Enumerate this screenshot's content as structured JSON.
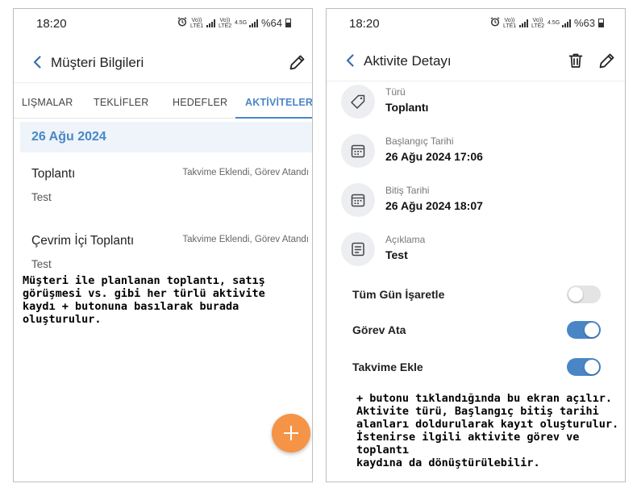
{
  "left": {
    "status": {
      "time": "18:20",
      "net1": "Vo)) LTE1",
      "net2": "Vo)) LTE2",
      "net3": "4.5G",
      "battery": "%64"
    },
    "appbar": {
      "title": "Müşteri Bilgileri"
    },
    "tabs": [
      {
        "label": "LIŞMALAR"
      },
      {
        "label": "TEKLİFLER"
      },
      {
        "label": "HEDEFLER"
      },
      {
        "label": "AKTİVİTELER",
        "active": true
      }
    ],
    "date_header": "26 Ağu 2024",
    "activities": [
      {
        "title": "Toplantı",
        "subtitle": "Test",
        "tags": "Takvime Eklendi, Görev Atandı"
      },
      {
        "title": "Çevrim İçi Toplantı",
        "subtitle": "Test",
        "tags": "Takvime Eklendi, Görev Atandı"
      }
    ],
    "note": "Müşteri ile planlanan toplantı, satış\ngörüşmesi vs. gibi her türlü aktivite\nkaydı + butonuna basılarak burada\noluşturulur."
  },
  "right": {
    "status": {
      "time": "18:20",
      "net1": "Vo)) LTE1",
      "net2": "Vo)) LTE2",
      "net3": "4.5G",
      "battery": "%63"
    },
    "appbar": {
      "title": "Aktivite Detayı"
    },
    "fields": [
      {
        "label": "Türü",
        "value": "Toplantı",
        "icon": "tag-icon"
      },
      {
        "label": "Başlangıç Tarihi",
        "value": "26 Ağu 2024 17:06",
        "icon": "calendar-icon"
      },
      {
        "label": "Bitiş Tarihi",
        "value": "26 Ağu 2024 18:07",
        "icon": "calendar-icon"
      },
      {
        "label": "Açıklama",
        "value": "Test",
        "icon": "note-icon"
      }
    ],
    "toggles": [
      {
        "label": "Tüm Gün İşaretle",
        "on": false
      },
      {
        "label": "Görev Ata",
        "on": true
      },
      {
        "label": "Takvime Ekle",
        "on": true
      }
    ],
    "note": "+ butonu tıklandığında bu ekran açılır.\nAktivite türü, Başlangıç bitiş tarihi\nalanları doldurularak kayıt oluşturulur.\nİstenirse ilgili aktivite görev ve toplantı\nkaydına da dönüştürülebilir."
  },
  "colors": {
    "accent": "#4a86c5",
    "fab": "#f59447",
    "date_bg": "#eef4fa"
  }
}
